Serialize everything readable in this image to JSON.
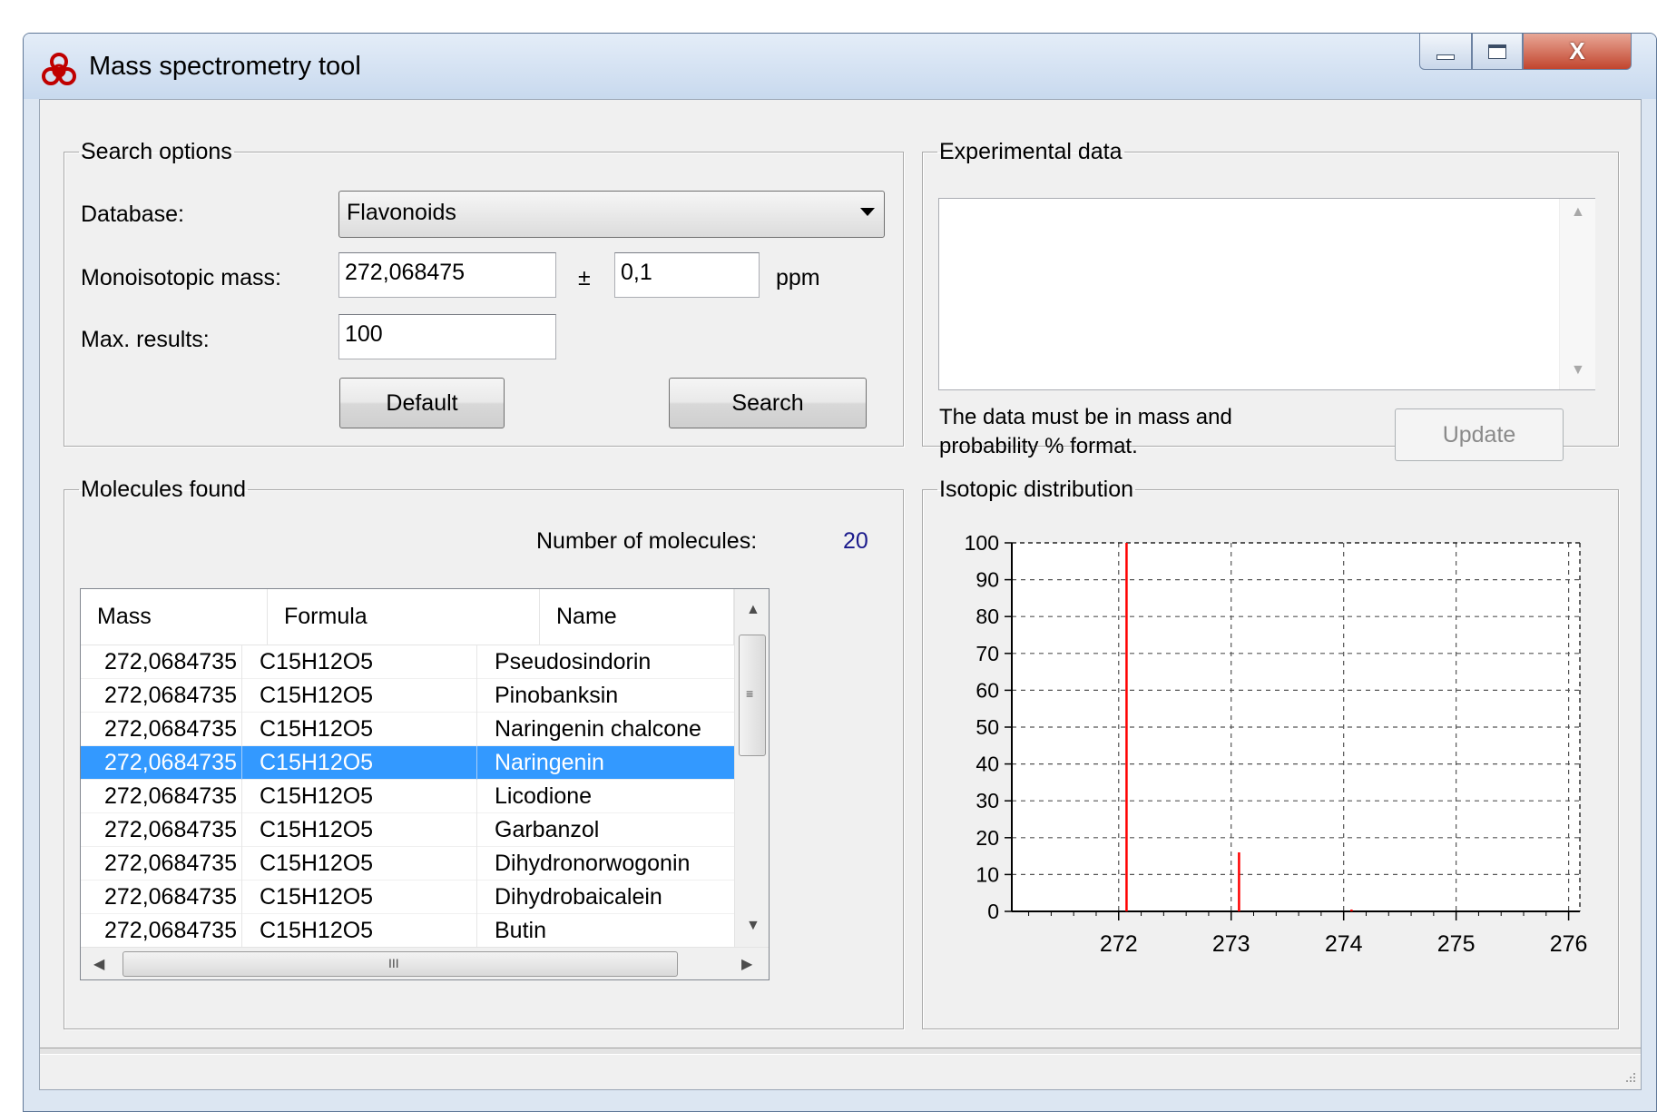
{
  "window": {
    "title": "Mass spectrometry tool",
    "icon": "biohazard-icon",
    "controls": [
      "minimize-icon",
      "maximize-icon",
      "close-icon"
    ],
    "close_glyph": "X"
  },
  "search_options": {
    "legend": "Search options",
    "database_label": "Database:",
    "database_value": "Flavonoids",
    "mass_label": "Monoisotopic mass:",
    "mass_value": "272,068475",
    "plusminus": "±",
    "tolerance_value": "0,1",
    "tolerance_unit": "ppm",
    "max_results_label": "Max. results:",
    "max_results_value": "100",
    "default_button": "Default",
    "search_button": "Search"
  },
  "experimental_data": {
    "legend": "Experimental data",
    "text_value": "",
    "hint": "The data must be in mass and probability % format.",
    "update_button": "Update"
  },
  "molecules_found": {
    "legend": "Molecules found",
    "count_label": "Number of molecules:",
    "count_value": "20",
    "count_color": "#1a1a8c",
    "columns": [
      "Mass",
      "Formula",
      "Name"
    ],
    "rows": [
      {
        "mass": "272,0684735",
        "formula": "C15H12O5",
        "name": "Pseudosindorin"
      },
      {
        "mass": "272,0684735",
        "formula": "C15H12O5",
        "name": "Pinobanksin"
      },
      {
        "mass": "272,0684735",
        "formula": "C15H12O5",
        "name": "Naringenin chalcone"
      },
      {
        "mass": "272,0684735",
        "formula": "C15H12O5",
        "name": "Naringenin"
      },
      {
        "mass": "272,0684735",
        "formula": "C15H12O5",
        "name": "Licodione"
      },
      {
        "mass": "272,0684735",
        "formula": "C15H12O5",
        "name": "Garbanzol"
      },
      {
        "mass": "272,0684735",
        "formula": "C15H12O5",
        "name": "Dihydronorwogonin"
      },
      {
        "mass": "272,0684735",
        "formula": "C15H12O5",
        "name": "Dihydrobaicalein"
      },
      {
        "mass": "272,0684735",
        "formula": "C15H12O5",
        "name": "Butin"
      }
    ],
    "selected_index": 3,
    "selection_color": "#3399ff",
    "hscroll_grip": "III"
  },
  "isotopic_distribution": {
    "legend": "Isotopic distribution"
  },
  "chart_data": {
    "type": "bar",
    "x": [
      272.07,
      273.07,
      274.07
    ],
    "values": [
      100,
      16,
      0.5
    ],
    "xlim": [
      271.05,
      276.1
    ],
    "ylim": [
      0,
      100
    ],
    "x_ticks": [
      272,
      273,
      274,
      275,
      276
    ],
    "y_ticks": [
      0,
      10,
      20,
      30,
      40,
      50,
      60,
      70,
      80,
      90,
      100
    ],
    "grid": true,
    "bar_color": "#ff0000",
    "title": "",
    "xlabel": "",
    "ylabel": ""
  }
}
